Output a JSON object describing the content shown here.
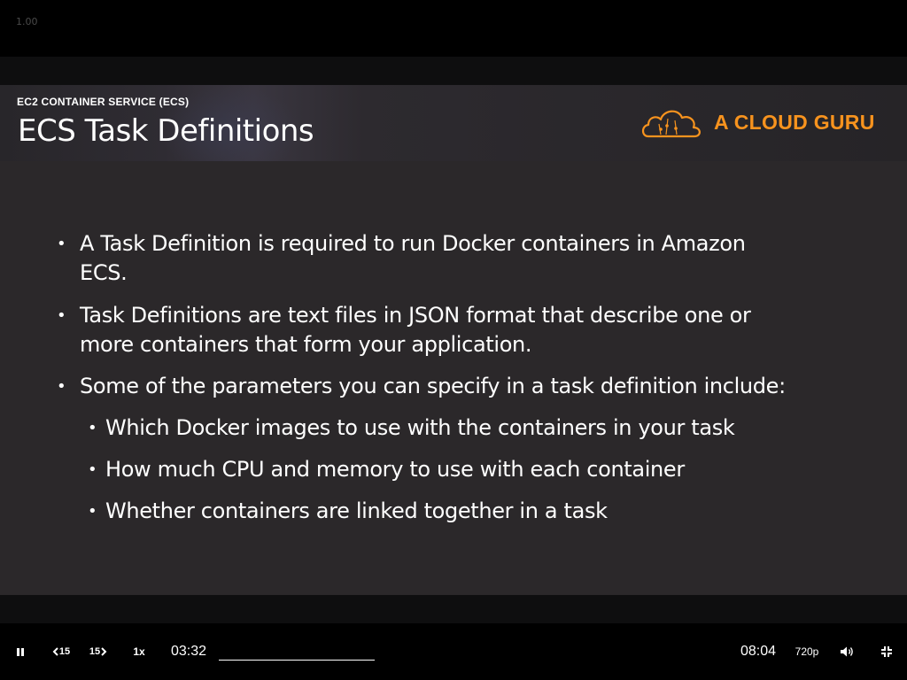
{
  "version_label": "1.00",
  "slide": {
    "kicker": "EC2 CONTAINER SERVICE (ECS)",
    "title": "ECS Task Definitions",
    "logo_text": "A CLOUD GURU",
    "bullets": [
      {
        "line1": "A Task Definition is required to run Docker containers in Amazon",
        "line2": "ECS."
      },
      {
        "line1": "Task Definitions are text files in JSON format that describe one or",
        "line2": "more containers that form your application."
      },
      {
        "line1": "Some of the parameters you can specify in a task definition include:"
      }
    ],
    "sub_bullets": [
      "Which Docker images to use with the containers in your task",
      "How much CPU and memory to use with each container",
      "Whether containers are linked together in a task"
    ],
    "bullet_glyph": "•",
    "sub_bullet_glyph": "•"
  },
  "controls": {
    "back_label": "15",
    "forward_label": "15",
    "speed_label": "1x",
    "current_time": "03:32",
    "total_time": "08:04",
    "quality_label": "720p",
    "progress_fraction": 1.0,
    "icons": [
      "pause-icon",
      "rewind-15-icon",
      "forward-15-icon",
      "volume-icon",
      "exit-fullscreen-icon"
    ]
  },
  "colors": {
    "accent": "#f7931e",
    "slide_bg": "#2b282a",
    "text": "#ffffff"
  }
}
